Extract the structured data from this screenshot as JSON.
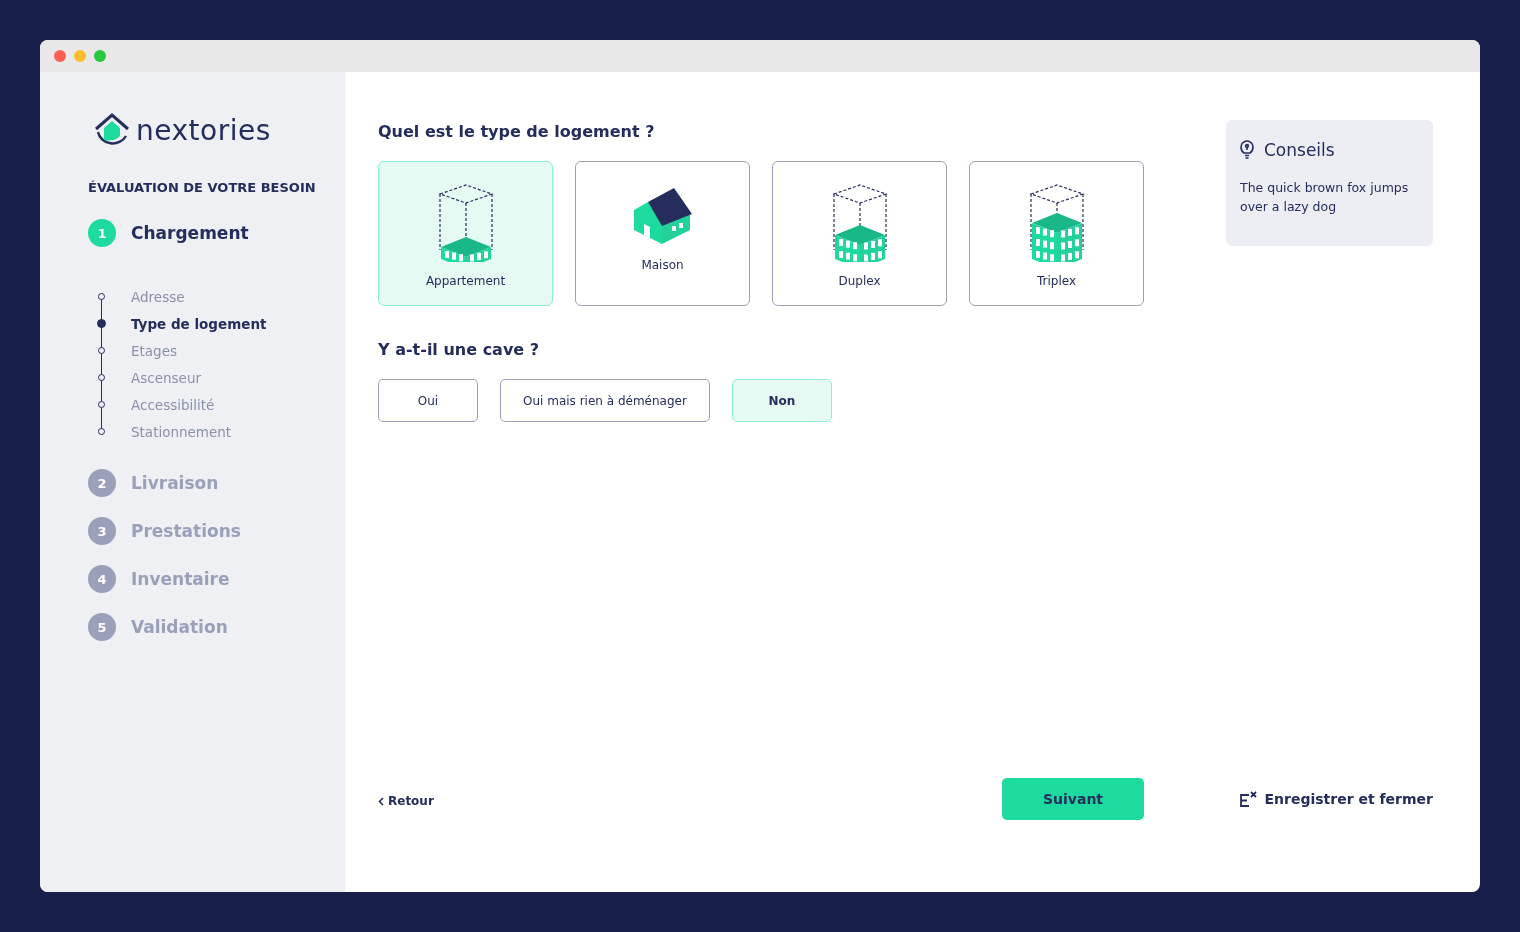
{
  "brand": {
    "name": "nextories"
  },
  "sidebar": {
    "heading": "ÉVALUATION DE VOTRE BESOIN",
    "steps": [
      {
        "number": "1",
        "label": "Chargement",
        "active": true,
        "children": [
          {
            "label": "Adresse",
            "selected": false
          },
          {
            "label": "Type de logement",
            "selected": true
          },
          {
            "label": "Etages",
            "selected": false
          },
          {
            "label": "Ascenseur",
            "selected": false
          },
          {
            "label": "Accessibilité",
            "selected": false
          },
          {
            "label": "Stationnement",
            "selected": false
          }
        ]
      },
      {
        "number": "2",
        "label": "Livraison",
        "active": false
      },
      {
        "number": "3",
        "label": "Prestations",
        "active": false
      },
      {
        "number": "4",
        "label": "Inventaire",
        "active": false
      },
      {
        "number": "5",
        "label": "Validation",
        "active": false
      }
    ]
  },
  "housing_question": {
    "title": "Quel est le type de logement ?",
    "options": [
      {
        "label": "Appartement",
        "kind": "apartment",
        "selected": true
      },
      {
        "label": "Maison",
        "kind": "house",
        "selected": false
      },
      {
        "label": "Duplex",
        "kind": "duplex",
        "selected": false
      },
      {
        "label": "Triplex",
        "kind": "triplex",
        "selected": false
      }
    ]
  },
  "cellar_question": {
    "title": "Y a-t-il une cave ?",
    "options": [
      {
        "label": "Oui",
        "selected": false
      },
      {
        "label": "Oui mais rien à déménager",
        "selected": false
      },
      {
        "label": "Non",
        "selected": true
      }
    ]
  },
  "tips": {
    "title": "Conseils",
    "text": "The quick brown fox jumps over a lazy dog"
  },
  "footer": {
    "back": "Retour",
    "next": "Suivant",
    "save": "Enregistrer et fermer"
  }
}
